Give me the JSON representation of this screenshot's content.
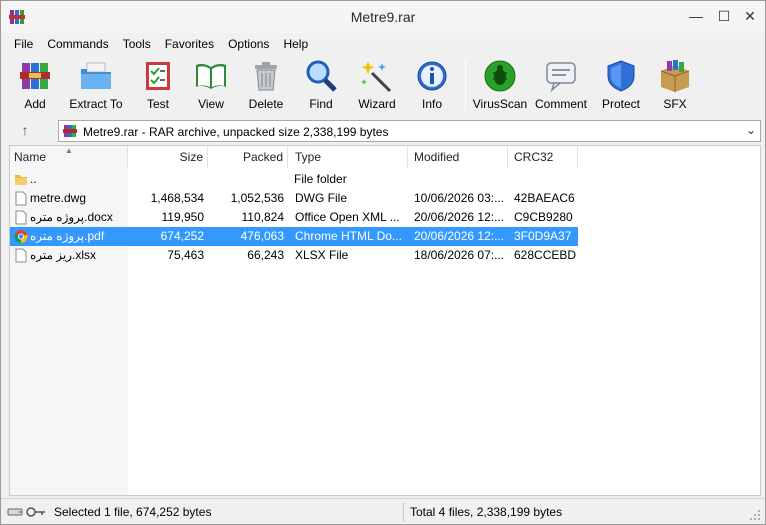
{
  "window": {
    "title": "Metre9.rar",
    "minimize": "—",
    "maximize": "☐",
    "close": "✕"
  },
  "menu": [
    "File",
    "Commands",
    "Tools",
    "Favorites",
    "Options",
    "Help"
  ],
  "toolbar": [
    {
      "label": "Add",
      "icon": "add-archive-icon"
    },
    {
      "label": "Extract To",
      "icon": "extract-folder-icon"
    },
    {
      "label": "Test",
      "icon": "test-checklist-icon"
    },
    {
      "label": "View",
      "icon": "view-book-icon"
    },
    {
      "label": "Delete",
      "icon": "trash-icon"
    },
    {
      "label": "Find",
      "icon": "magnifier-icon"
    },
    {
      "label": "Wizard",
      "icon": "wand-icon"
    },
    {
      "label": "Info",
      "icon": "info-icon"
    },
    {
      "label": "VirusScan",
      "icon": "bug-scan-icon"
    },
    {
      "label": "Comment",
      "icon": "comment-icon"
    },
    {
      "label": "Protect",
      "icon": "shield-icon"
    },
    {
      "label": "SFX",
      "icon": "sfx-box-icon"
    }
  ],
  "address": {
    "up": "↑",
    "path": "Metre9.rar - RAR archive, unpacked size 2,338,199 bytes",
    "dropdown": "⌄"
  },
  "columns": {
    "name": "Name",
    "size": "Size",
    "packed": "Packed",
    "type": "Type",
    "modified": "Modified",
    "crc": "CRC32"
  },
  "files": [
    {
      "name": "..",
      "size": "",
      "packed": "",
      "type": "File folder",
      "modified": "",
      "crc": "",
      "icon": "folder-icon",
      "selected": false
    },
    {
      "name": "metre.dwg",
      "size": "1,468,534",
      "packed": "1,052,536",
      "type": "DWG File",
      "modified": "10/06/2026 03:...",
      "crc": "42BAEAC6",
      "icon": "file-icon",
      "selected": false
    },
    {
      "name": "پروژه متره.docx",
      "size": "119,950",
      "packed": "110,824",
      "type": "Office Open XML ...",
      "modified": "20/06/2026 12:...",
      "crc": "C9CB9280",
      "icon": "file-icon",
      "selected": false
    },
    {
      "name": "پروژه متره.pdf",
      "size": "674,252",
      "packed": "476,063",
      "type": "Chrome HTML Do...",
      "modified": "20/06/2026 12:...",
      "crc": "3F0D9A37",
      "icon": "chrome-icon",
      "selected": true
    },
    {
      "name": "ریز متره.xlsx",
      "size": "75,463",
      "packed": "66,243",
      "type": "XLSX File",
      "modified": "18/06/2026 07:...",
      "crc": "628CCEBD",
      "icon": "file-icon",
      "selected": false
    }
  ],
  "status": {
    "left": "Selected 1 file, 674,252 bytes",
    "right": "Total 4 files, 2,338,199 bytes"
  }
}
